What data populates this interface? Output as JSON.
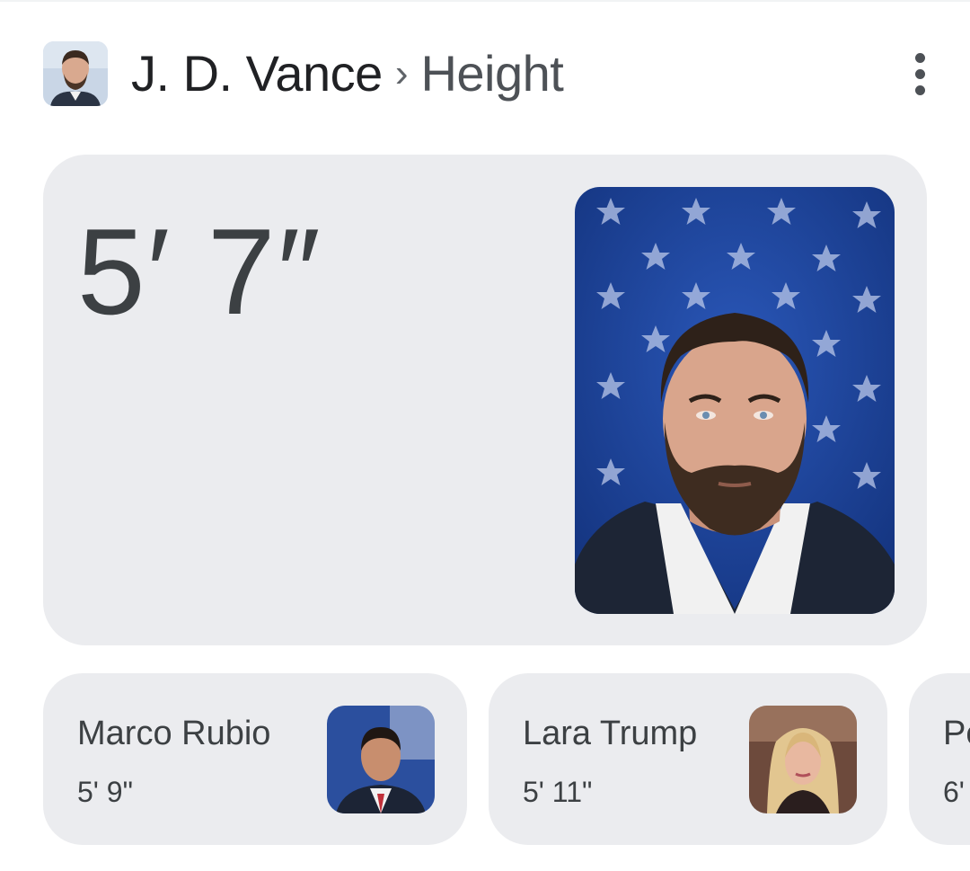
{
  "header": {
    "entity": "J. D. Vance",
    "separator": "›",
    "attribute": "Height",
    "more_icon": "more-vert-icon"
  },
  "answer": {
    "value": "5′ 7″"
  },
  "related": [
    {
      "name": "Marco Rubio",
      "height": "5' 9\""
    },
    {
      "name": "Lara Trump",
      "height": "5' 11\""
    },
    {
      "name": "Pe",
      "height": "6'"
    }
  ],
  "colors": {
    "card_bg": "#ebecef",
    "text_primary": "#202124",
    "text_secondary": "#4d5156",
    "photo_bg_blue": "#1c3f93"
  }
}
